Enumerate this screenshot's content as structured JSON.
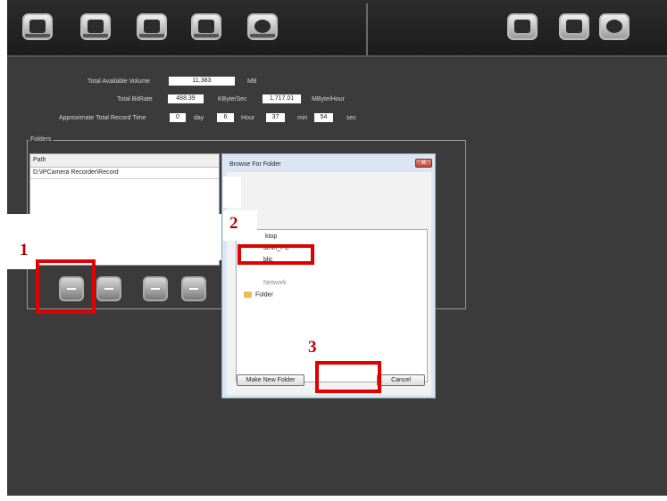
{
  "toolbar": {
    "left_buttons": [
      "camera-icon",
      "camera-settings-icon",
      "recorder-icon",
      "storage-icon",
      "options-icon"
    ],
    "right_buttons": [
      "keyboard-icon",
      "save-icon",
      "power-icon"
    ]
  },
  "settings": {
    "total_available_volume_label": "Total Available Volume",
    "total_available_volume_value": "11,383",
    "total_available_volume_unit": "MB",
    "total_bitrate_label": "Total BitRate",
    "bitrate_kbyte_value": "488.39",
    "bitrate_kbyte_unit": "KByte/Sec",
    "bitrate_mbyte_value": "1,717.01",
    "bitrate_mbyte_unit": "MByte/Hour",
    "record_time_label": "Approximate Total Record Time",
    "record_day_value": "0",
    "record_day_unit": "day",
    "record_hour_value": "6",
    "record_hour_unit": "Hour",
    "record_min_value": "37",
    "record_min_unit": "min",
    "record_sec_value": "54",
    "record_sec_unit": "sec"
  },
  "folders": {
    "group_title": "Folders",
    "column_header": "Path",
    "rows": [
      "D:\\IPCamera Recorder\\Record"
    ]
  },
  "dialog": {
    "title": "Browse For Folder",
    "close_label": "✕",
    "tree": {
      "desktop": "ktop",
      "user": "dmin_PC",
      "partial": "blic",
      "network": "Network",
      "folder": "Folder"
    },
    "make_new_folder_label": "Make New Folder",
    "cancel_label": "Cancel"
  },
  "annotations": {
    "step1": "1",
    "step2": "2",
    "step3": "3",
    "marker_color": "#e00000"
  }
}
